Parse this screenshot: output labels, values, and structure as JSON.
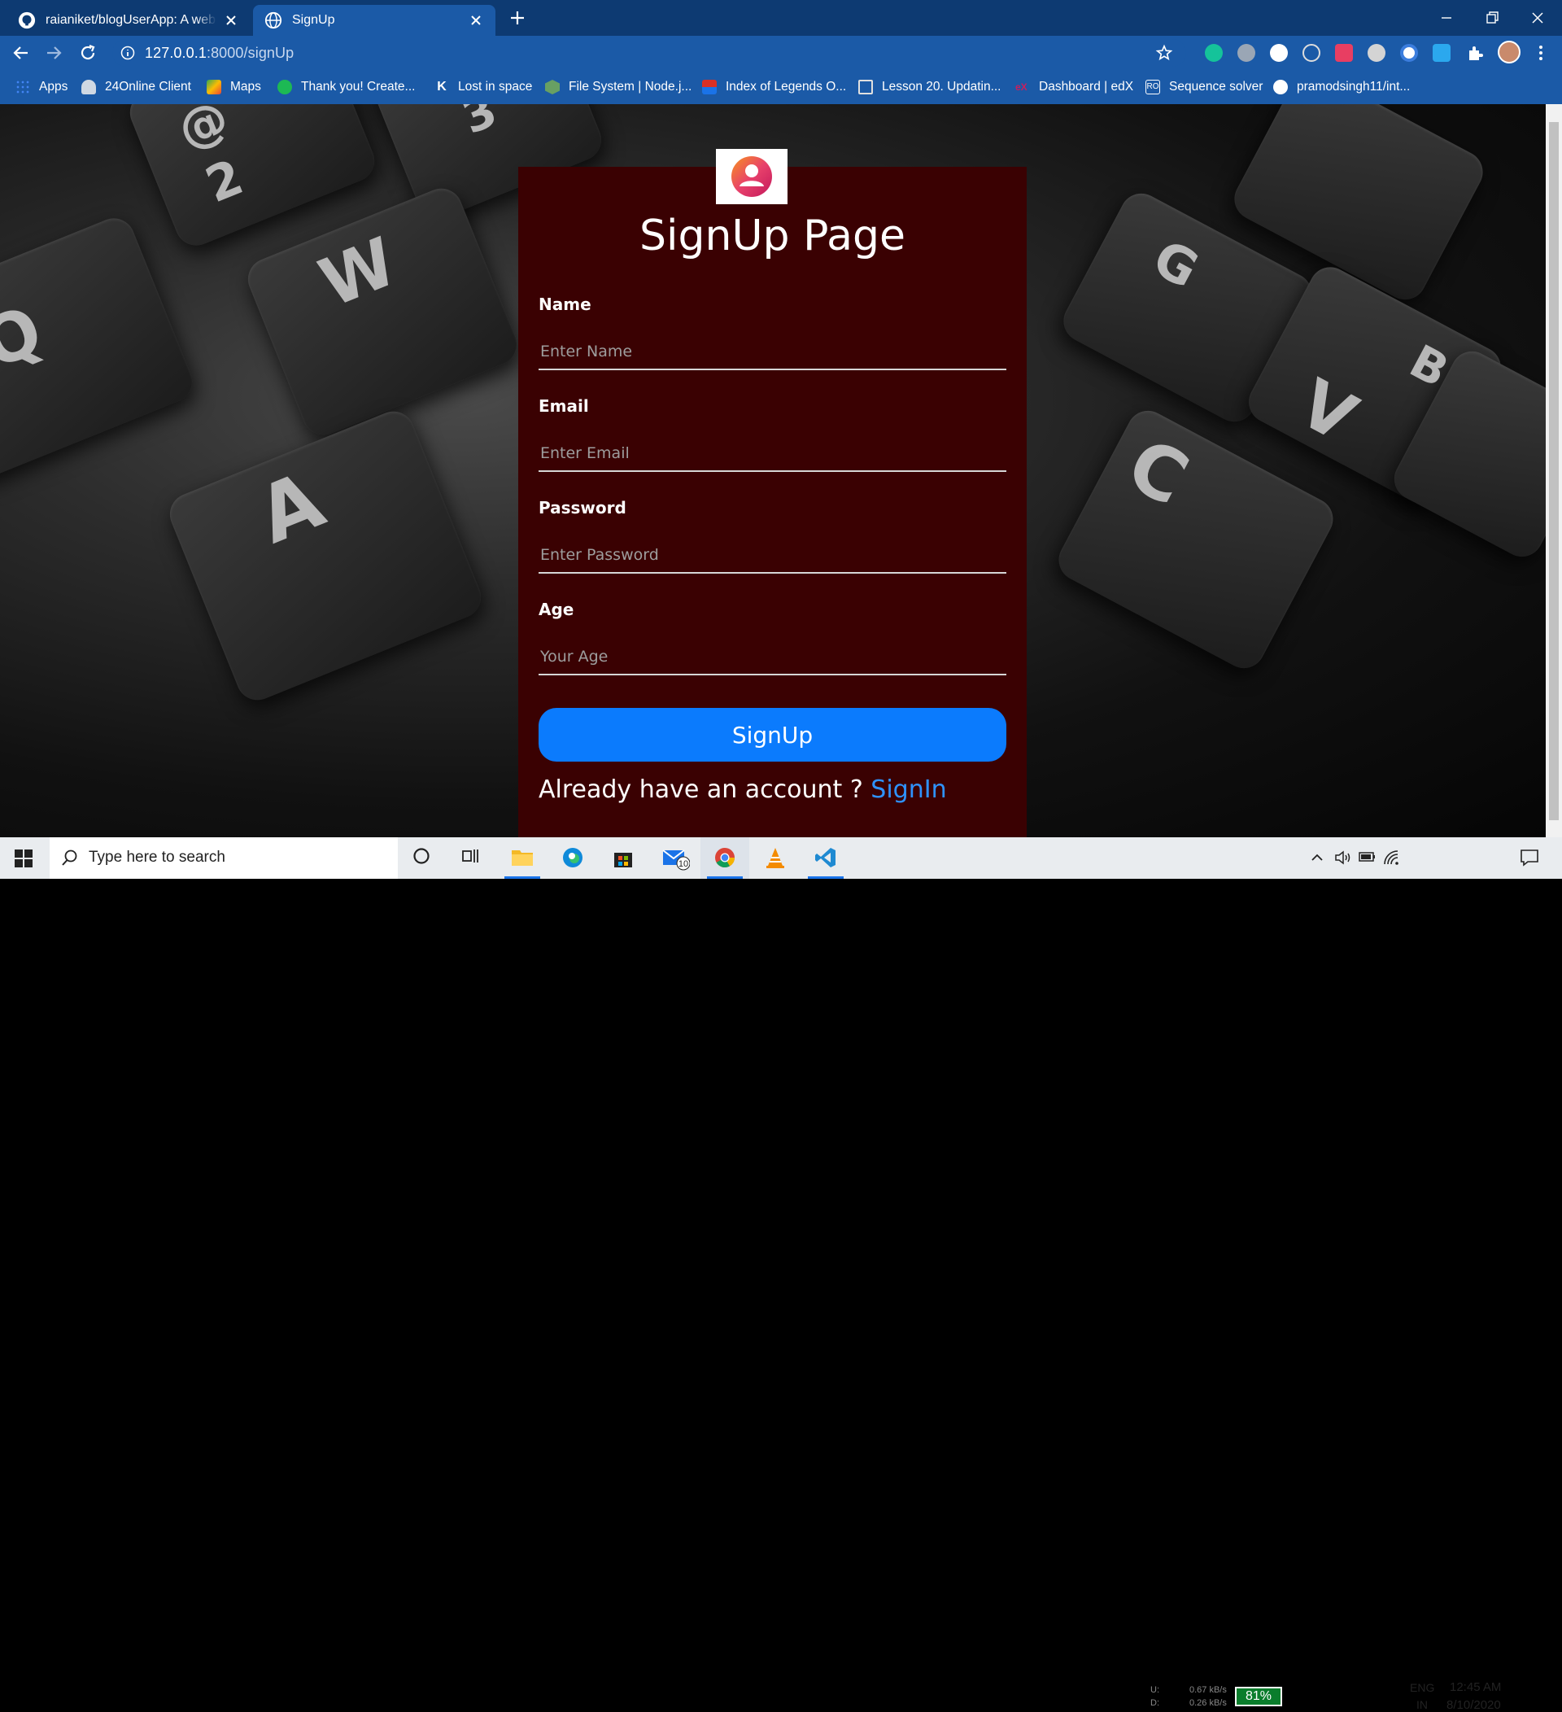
{
  "tabs": [
    {
      "title": "raianiket/blogUserApp: A web app",
      "active": false,
      "icon": "github-icon"
    },
    {
      "title": "SignUp",
      "active": true,
      "icon": "globe-icon"
    }
  ],
  "toolbar": {
    "url_host": "127.0.0.1",
    "url_path": ":8000/signUp"
  },
  "bookmarks": [
    {
      "label": "Apps",
      "icon": "apps-grid-icon",
      "color": "#4285f4"
    },
    {
      "label": "24Online Client",
      "icon": "cloud-icon",
      "color": "#cfd8e3"
    },
    {
      "label": "Maps",
      "icon": "maps-icon",
      "color": "#34a853"
    },
    {
      "label": "Thank you! Create...",
      "icon": "green-check-icon",
      "color": "#1db954"
    },
    {
      "label": "Lost in space",
      "icon": "k-icon",
      "color": "#ffffff"
    },
    {
      "label": "File System | Node.j...",
      "icon": "nodejs-icon",
      "color": "#68a063"
    },
    {
      "label": "Index of Legends O...",
      "icon": "legends-icon",
      "color": "#d93025"
    },
    {
      "label": "Lesson 20. Updatin...",
      "icon": "lesson-icon",
      "color": "#e0e0e0"
    },
    {
      "label": "Dashboard | edX",
      "icon": "edx-icon",
      "color": "#c71f5e"
    },
    {
      "label": "Sequence solver",
      "icon": "sequence-icon",
      "color": "#ffffff"
    },
    {
      "label": "pramodsingh11/int...",
      "icon": "github-icon",
      "color": "#ffffff"
    }
  ],
  "page": {
    "title": "SignUp Page",
    "fields": [
      {
        "label": "Name",
        "placeholder": "Enter Name"
      },
      {
        "label": "Email",
        "placeholder": "Enter Email"
      },
      {
        "label": "Password",
        "placeholder": "Enter Password"
      },
      {
        "label": "Age",
        "placeholder": "Your Age"
      }
    ],
    "submit_label": "SignUp",
    "account_prompt": "Already have an account ? ",
    "signin_label": "SignIn"
  },
  "taskbar": {
    "search_placeholder": "Type here to search",
    "net_up_label": "U:",
    "net_down_label": "D:",
    "net_up_speed": "0.67 kB/s",
    "net_down_speed": "0.26 kB/s",
    "battery": "81%",
    "lang_top": "ENG",
    "lang_bottom": "IN",
    "time": "12:45 AM",
    "date": "8/10/2020",
    "mail_badge": "10"
  },
  "colors": {
    "card_bg": "#3a0102",
    "button_bg": "#0b7bfd",
    "link": "#2f93ff",
    "chrome_toolbar": "#1b5aa7",
    "chrome_tabstrip": "#0d3a72"
  }
}
